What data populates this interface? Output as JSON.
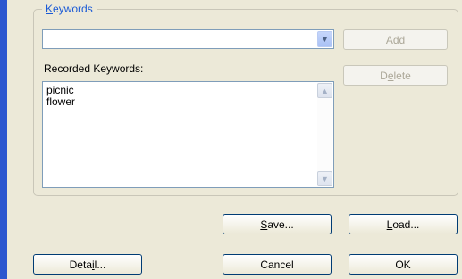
{
  "keywords_group": {
    "legend": "Keywords",
    "legend_mnemonic": "K",
    "combo_value": "",
    "recorded_label": "Recorded Keywords:",
    "recorded_items": [
      "picnic",
      "flower"
    ]
  },
  "buttons": {
    "add": {
      "label_rest": "dd",
      "mnemonic": "A",
      "enabled": false
    },
    "delete": {
      "label_pre": "D",
      "mnemonic": "e",
      "label_post": "lete",
      "enabled": false
    },
    "save": {
      "mnemonic": "S",
      "label_rest": "ave..."
    },
    "load": {
      "mnemonic": "L",
      "label_rest": "oad..."
    },
    "detail": {
      "label_pre": "Deta",
      "mnemonic": "i",
      "label_post": "l..."
    },
    "cancel": {
      "label": "Cancel"
    },
    "ok": {
      "label": "OK"
    }
  },
  "colors": {
    "background": "#ece9d8",
    "accent": "#1a5ad6",
    "sidebar_stripe": "#2c57cf",
    "disabled_text": "#aca899"
  },
  "icons": {
    "combo_dropdown": "chevron-down-icon",
    "scroll_up": "up-arrow-icon",
    "scroll_down": "down-arrow-icon"
  }
}
